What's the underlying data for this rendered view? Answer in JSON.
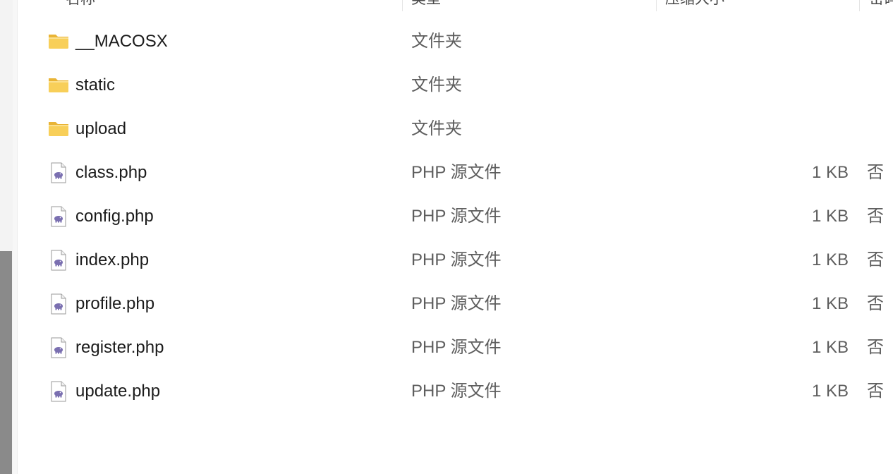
{
  "header": {
    "columns": [
      {
        "label": "名称"
      },
      {
        "label": "类型"
      },
      {
        "label": "压缩大小"
      },
      {
        "label": "密码"
      }
    ]
  },
  "files": [
    {
      "name": "__MACOSX",
      "type": "文件夹",
      "size": "",
      "extra": "",
      "icon": "folder-icon"
    },
    {
      "name": "static",
      "type": "文件夹",
      "size": "",
      "extra": "",
      "icon": "folder-icon"
    },
    {
      "name": "upload",
      "type": "文件夹",
      "size": "",
      "extra": "",
      "icon": "folder-icon"
    },
    {
      "name": "class.php",
      "type": "PHP 源文件",
      "size": "1 KB",
      "extra": "否",
      "icon": "php-file-icon"
    },
    {
      "name": "config.php",
      "type": "PHP 源文件",
      "size": "1 KB",
      "extra": "否",
      "icon": "php-file-icon"
    },
    {
      "name": "index.php",
      "type": "PHP 源文件",
      "size": "1 KB",
      "extra": "否",
      "icon": "php-file-icon"
    },
    {
      "name": "profile.php",
      "type": "PHP 源文件",
      "size": "1 KB",
      "extra": "否",
      "icon": "php-file-icon"
    },
    {
      "name": "register.php",
      "type": "PHP 源文件",
      "size": "1 KB",
      "extra": "否",
      "icon": "php-file-icon"
    },
    {
      "name": "update.php",
      "type": "PHP 源文件",
      "size": "1 KB",
      "extra": "否",
      "icon": "php-file-icon"
    }
  ],
  "colors": {
    "folder": "#f8cf59",
    "folder_tab": "#e9b436",
    "php_elephant": "#7a6fb0"
  }
}
